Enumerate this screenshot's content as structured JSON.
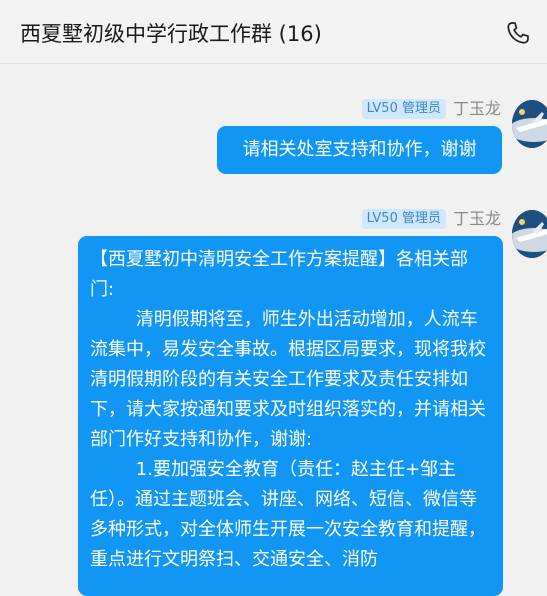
{
  "header": {
    "title": "西夏墅初级中学行政工作群 (16)",
    "call_icon": "phone-icon"
  },
  "messages": [
    {
      "sender": "丁玉龙",
      "badge": "LV50 管理员",
      "text": "请相关处室支持和协作，谢谢"
    },
    {
      "sender": "丁玉龙",
      "badge": "LV50 管理员",
      "paragraphs": [
        "【西夏墅初中清明安全工作方案提醒】各相关部门:",
        "        清明假期将至，师生外出活动增加，人流车流集中，易发安全事故。根据区局要求，现将我校清明假期阶段的有关安全工作要求及责任安排如下，请大家按通知要求及时组织落实的，并请相关部门作好支持和协作，谢谢:",
        "        1.要加强安全教育（责任：赵主任+邹主任）。通过主题班会、讲座、网络、短信、微信等多种形式，对全体师生开展一次安全教育和提醒，重点进行文明祭扫、交通安全、消防"
      ]
    }
  ],
  "colors": {
    "bubble": "#1296f3",
    "badge_bg": "#cfe8fb",
    "badge_text": "#3a86d0",
    "background": "#f1f1f1"
  }
}
